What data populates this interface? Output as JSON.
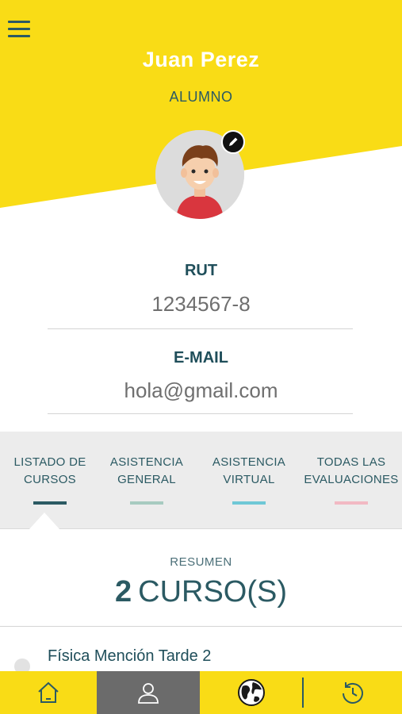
{
  "profile": {
    "name": "Juan Perez",
    "role": "ALUMNO"
  },
  "fields": {
    "rut_label": "RUT",
    "rut_value": "1234567-8",
    "email_label": "E-MAIL",
    "email_value": "hola@gmail.com"
  },
  "tabs": [
    {
      "line1": "LISTADO DE",
      "line2": "CURSOS",
      "color": "#2b5a63"
    },
    {
      "line1": "ASISTENCIA",
      "line2": "GENERAL",
      "color": "#a7cbc0"
    },
    {
      "line1": "ASISTENCIA",
      "line2": "VIRTUAL",
      "color": "#6fc8d6"
    },
    {
      "line1": "TODAS LAS",
      "line2": "EVALUACIONES",
      "color": "#f2b9c3"
    }
  ],
  "summary": {
    "label": "RESUMEN",
    "count": "2",
    "unit": "CURSO(S)"
  },
  "courses": [
    {
      "title": "Física Mención Tarde 2"
    }
  ],
  "bottom_nav": [
    {
      "icon": "home-icon"
    },
    {
      "icon": "user-icon",
      "active": true
    },
    {
      "icon": "globe-icon"
    },
    {
      "icon": "history-icon"
    }
  ],
  "colors": {
    "brand_yellow": "#f9dc16",
    "accent_teal": "#2b5a63"
  }
}
